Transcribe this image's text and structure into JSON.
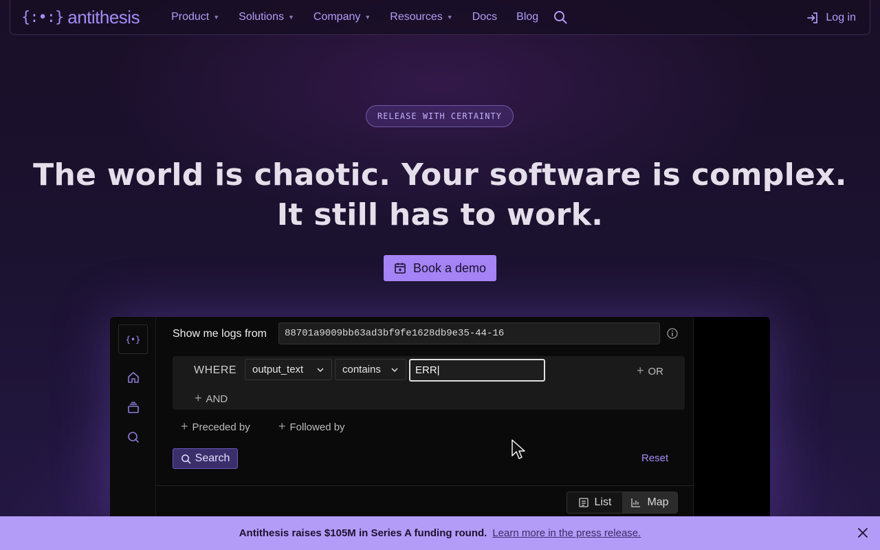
{
  "brand": {
    "mark": "{:•:}",
    "name": "antithesis"
  },
  "nav": {
    "items": [
      {
        "label": "Product",
        "dropdown": true
      },
      {
        "label": "Solutions",
        "dropdown": true
      },
      {
        "label": "Company",
        "dropdown": true
      },
      {
        "label": "Resources",
        "dropdown": true
      },
      {
        "label": "Docs",
        "dropdown": false
      },
      {
        "label": "Blog",
        "dropdown": false
      }
    ],
    "search_icon": "search-icon",
    "login_label": "Log in"
  },
  "hero": {
    "pill": "RELEASE WITH CERTAINTY",
    "headline_line1": "The world is chaotic. Your software is complex.",
    "headline_line2": "It still has to work.",
    "cta_label": "Book a demo"
  },
  "demo": {
    "sidebar_logo": "{•}",
    "show_label": "Show me logs from",
    "run_id": "88701a9009bb63ad3bf9fe1628db9e35-44-16",
    "where_label": "WHERE",
    "field_select": "output_text",
    "op_select": "contains",
    "value_input": "ERR",
    "or_label": "OR",
    "and_label": "AND",
    "preceded_label": "Preceded by",
    "followed_label": "Followed by",
    "search_label": "Search",
    "reset_label": "Reset",
    "view_toggle": [
      {
        "label": "List",
        "active": false
      },
      {
        "label": "Map",
        "active": true
      }
    ]
  },
  "banner": {
    "text": "Antithesis raises $105M in Series A funding round.",
    "link": "Learn more in the press release."
  },
  "colors": {
    "accent": "#a685f6",
    "banner_bg": "#b39cf8",
    "page_bg": "#1b1230"
  }
}
